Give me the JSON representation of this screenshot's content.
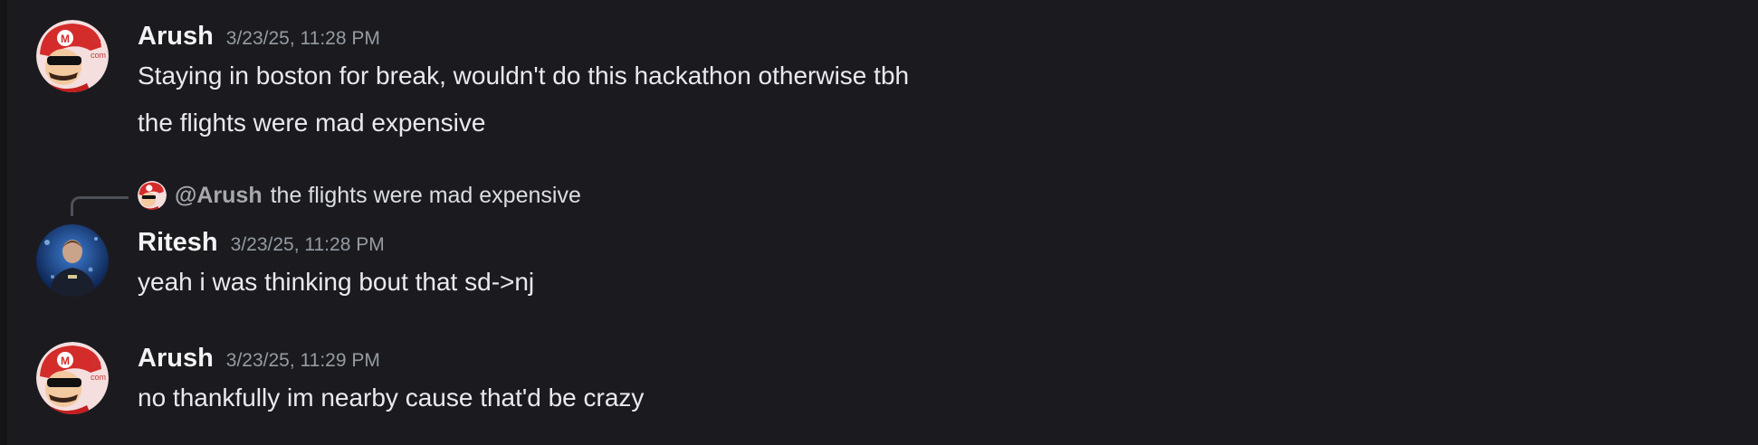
{
  "messages": [
    {
      "username": "Arush",
      "timestamp": "3/23/25, 11:28 PM",
      "lines": [
        "Staying in boston for break, wouldn't do this hackathon otherwise tbh",
        "the flights were mad expensive"
      ]
    },
    {
      "reply": {
        "mention": "@Arush",
        "text": "the flights were mad expensive"
      },
      "username": "Ritesh",
      "timestamp": "3/23/25, 11:28 PM",
      "lines": [
        "yeah i was thinking bout that sd->nj"
      ]
    },
    {
      "username": "Arush",
      "timestamp": "3/23/25, 11:29 PM",
      "lines": [
        "no thankfully im nearby cause that'd be crazy"
      ]
    }
  ],
  "colors": {
    "background": "#1b1b1f",
    "username": "#f2f3f5",
    "timestamp": "#949ba4",
    "message_text": "#e9eaee",
    "reply_mention": "#a6a8ad"
  },
  "icons": {
    "arush_avatar": "mario-avatar-icon",
    "ritesh_avatar": "soccer-player-avatar-icon"
  }
}
